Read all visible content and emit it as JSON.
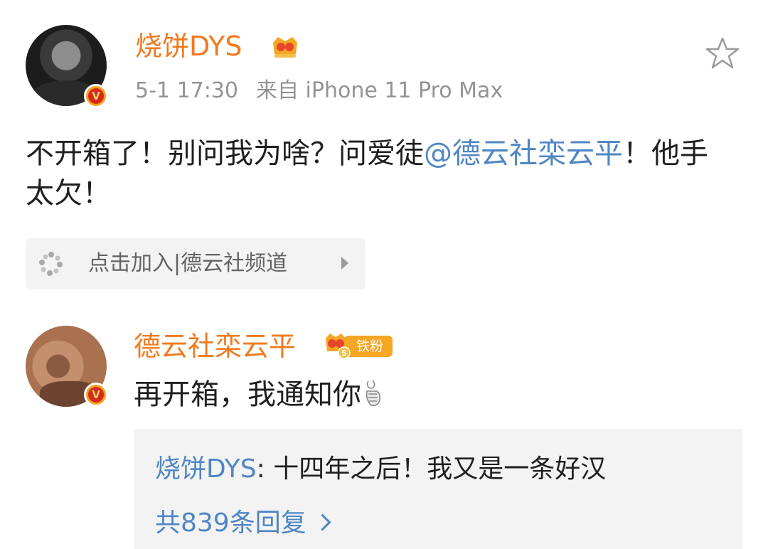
{
  "post": {
    "username": "烧饼DYS",
    "time": "5-1 17:30",
    "source": "来自 iPhone 11 Pro Max",
    "text_before_mention": "不开箱了！别问我为啥？问爱徒",
    "mention": "@德云社栾云平",
    "text_after_mention": "！他手太欠！",
    "verified_badge": "V"
  },
  "channel": {
    "label": "点击加入|德云社频道"
  },
  "reply": {
    "username": "德云社栾云平",
    "fan_badge_label": "铁粉",
    "text": "再开箱，我通知你",
    "verified_badge": "V",
    "sub_reply": {
      "username": "烧饼DYS",
      "separator": ": ",
      "text": "十四年之后！我又是一条好汉"
    },
    "more_replies": "共839条回复"
  },
  "colors": {
    "username": "#f07a1e",
    "link": "#4f86c4",
    "meta": "#939393",
    "chip_bg": "#f3f3f3"
  },
  "icons": {
    "star": "star-outline-icon",
    "member_badge": "vip-crown-icon",
    "fan_badge": "fan-badge-icon",
    "channel": "dots-circle-icon",
    "hand": "finger-heart-emoji-icon"
  }
}
